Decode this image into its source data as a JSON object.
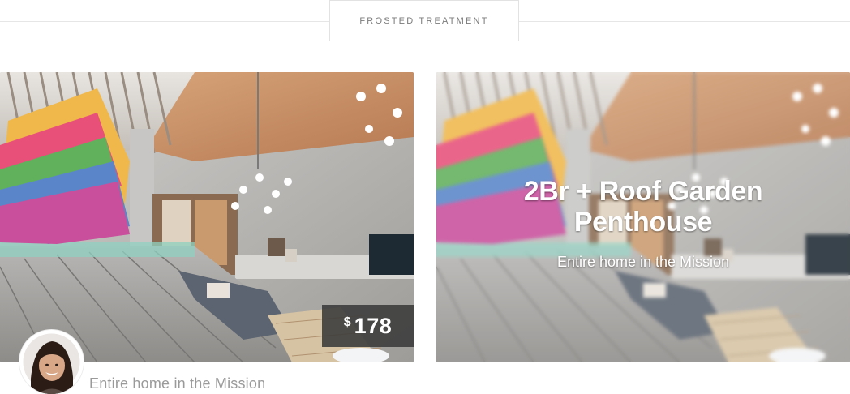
{
  "header": {
    "section_label": "FROSTED TREATMENT"
  },
  "cards": [
    {
      "price_currency": "$",
      "price_value": "178",
      "description": "Entire home in the Mission"
    },
    {
      "title_line_1": "2Br + Roof Garden",
      "title_line_2": "Penthouse",
      "subtitle": "Entire home in the Mission"
    }
  ],
  "icons": {
    "host_avatar": "avatar"
  },
  "colors": {
    "badge_background": "#3a3a3a",
    "caption_text": "#9a9a9a",
    "divider": "#e6e6e6"
  }
}
